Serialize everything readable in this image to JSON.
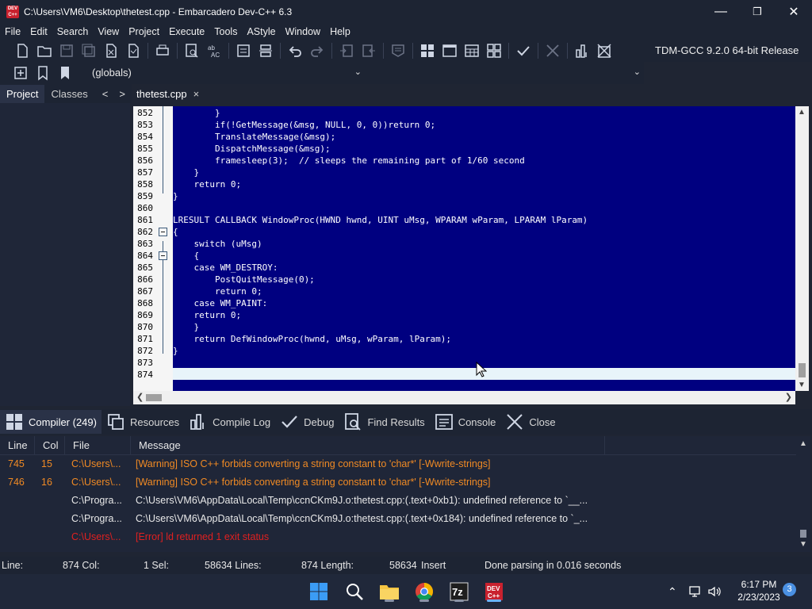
{
  "window": {
    "title": "C:\\Users\\VM6\\Desktop\\thetest.cpp - Embarcadero Dev-C++ 6.3",
    "app_icon_text": "DEV C++"
  },
  "menu": [
    "File",
    "Edit",
    "Search",
    "View",
    "Project",
    "Execute",
    "Tools",
    "AStyle",
    "Window",
    "Help"
  ],
  "toolbar": {
    "compiler": "TDM-GCC 9.2.0 64-bit Release",
    "scope": "(globals)"
  },
  "left_panel": {
    "tabs": [
      "Project",
      "Classes"
    ],
    "active": "Project",
    "prev": "<",
    "next": ">"
  },
  "editor": {
    "tab_label": "thetest.cpp",
    "tab_close": "×",
    "lines": [
      {
        "n": "852",
        "t": "        }"
      },
      {
        "n": "853",
        "t": "        if(!GetMessage(&msg, NULL, 0, 0))return 0;"
      },
      {
        "n": "854",
        "t": "        TranslateMessage(&msg);"
      },
      {
        "n": "855",
        "t": "        DispatchMessage(&msg);"
      },
      {
        "n": "856",
        "t": "        framesleep(3);  // sleeps the remaining part of 1/60 second"
      },
      {
        "n": "857",
        "t": "    }"
      },
      {
        "n": "858",
        "t": "    return 0;"
      },
      {
        "n": "859",
        "t": "}"
      },
      {
        "n": "860",
        "t": ""
      },
      {
        "n": "861",
        "t": "LRESULT CALLBACK WindowProc(HWND hwnd, UINT uMsg, WPARAM wParam, LPARAM lParam)"
      },
      {
        "n": "862",
        "t": "{"
      },
      {
        "n": "863",
        "t": "    switch (uMsg)"
      },
      {
        "n": "864",
        "t": "    {"
      },
      {
        "n": "865",
        "t": "    case WM_DESTROY:"
      },
      {
        "n": "866",
        "t": "        PostQuitMessage(0);"
      },
      {
        "n": "867",
        "t": "        return 0;"
      },
      {
        "n": "868",
        "t": "    case WM_PAINT:"
      },
      {
        "n": "869",
        "t": "    return 0;"
      },
      {
        "n": "870",
        "t": "    }"
      },
      {
        "n": "871",
        "t": "    return DefWindowProc(hwnd, uMsg, wParam, lParam);"
      },
      {
        "n": "872",
        "t": "}"
      },
      {
        "n": "873",
        "t": ""
      },
      {
        "n": "874",
        "t": ""
      }
    ]
  },
  "bottom_tabs": [
    {
      "label": "Compiler (249)",
      "icon": "grid-icon",
      "active": true
    },
    {
      "label": "Resources",
      "icon": "resources-icon",
      "active": false
    },
    {
      "label": "Compile Log",
      "icon": "bar-chart-icon",
      "active": false
    },
    {
      "label": "Debug",
      "icon": "check-icon",
      "active": false
    },
    {
      "label": "Find Results",
      "icon": "find-icon",
      "active": false
    },
    {
      "label": "Console",
      "icon": "console-icon",
      "active": false
    },
    {
      "label": "Close",
      "icon": "close-icon",
      "active": false
    }
  ],
  "messages": {
    "headers": [
      "Line",
      "Col",
      "File",
      "Message"
    ],
    "rows": [
      {
        "line": "745",
        "col": "15",
        "file": "C:\\Users\\...",
        "msg": "[Warning] ISO C++ forbids converting a string constant to 'char*' [-Wwrite-strings]",
        "color": "#f08a24"
      },
      {
        "line": "746",
        "col": "16",
        "file": "C:\\Users\\...",
        "msg": "[Warning] ISO C++ forbids converting a string constant to 'char*' [-Wwrite-strings]",
        "color": "#f08a24"
      },
      {
        "line": "",
        "col": "",
        "file": "C:\\Progra...",
        "msg": "C:\\Users\\VM6\\AppData\\Local\\Temp\\ccnCKm9J.o:thetest.cpp:(.text+0xb1): undefined reference to `__...",
        "color": "#e8e8e8"
      },
      {
        "line": "",
        "col": "",
        "file": "C:\\Progra...",
        "msg": "C:\\Users\\VM6\\AppData\\Local\\Temp\\ccnCKm9J.o:thetest.cpp:(.text+0x184): undefined reference to `_...",
        "color": "#e8e8e8"
      },
      {
        "line": "",
        "col": "",
        "file": "C:\\Users\\...",
        "msg": "[Error] ld returned 1 exit status",
        "color": "#e02020"
      }
    ]
  },
  "status": {
    "line_label": "Line:",
    "line_val": "874 Col:",
    "col_val": "1 Sel:",
    "sel_val": "58634 Lines:",
    "lines_val": "874 Length:",
    "length_val": "58634",
    "mode": "Insert",
    "parse": "Done parsing in 0.016 seconds"
  },
  "taskbar": {
    "time": "6:17 PM",
    "date": "2/23/2023",
    "notifications": "3"
  },
  "colors": {
    "editor_bg": "#000080",
    "warning": "#f08a24",
    "error": "#e02020"
  }
}
